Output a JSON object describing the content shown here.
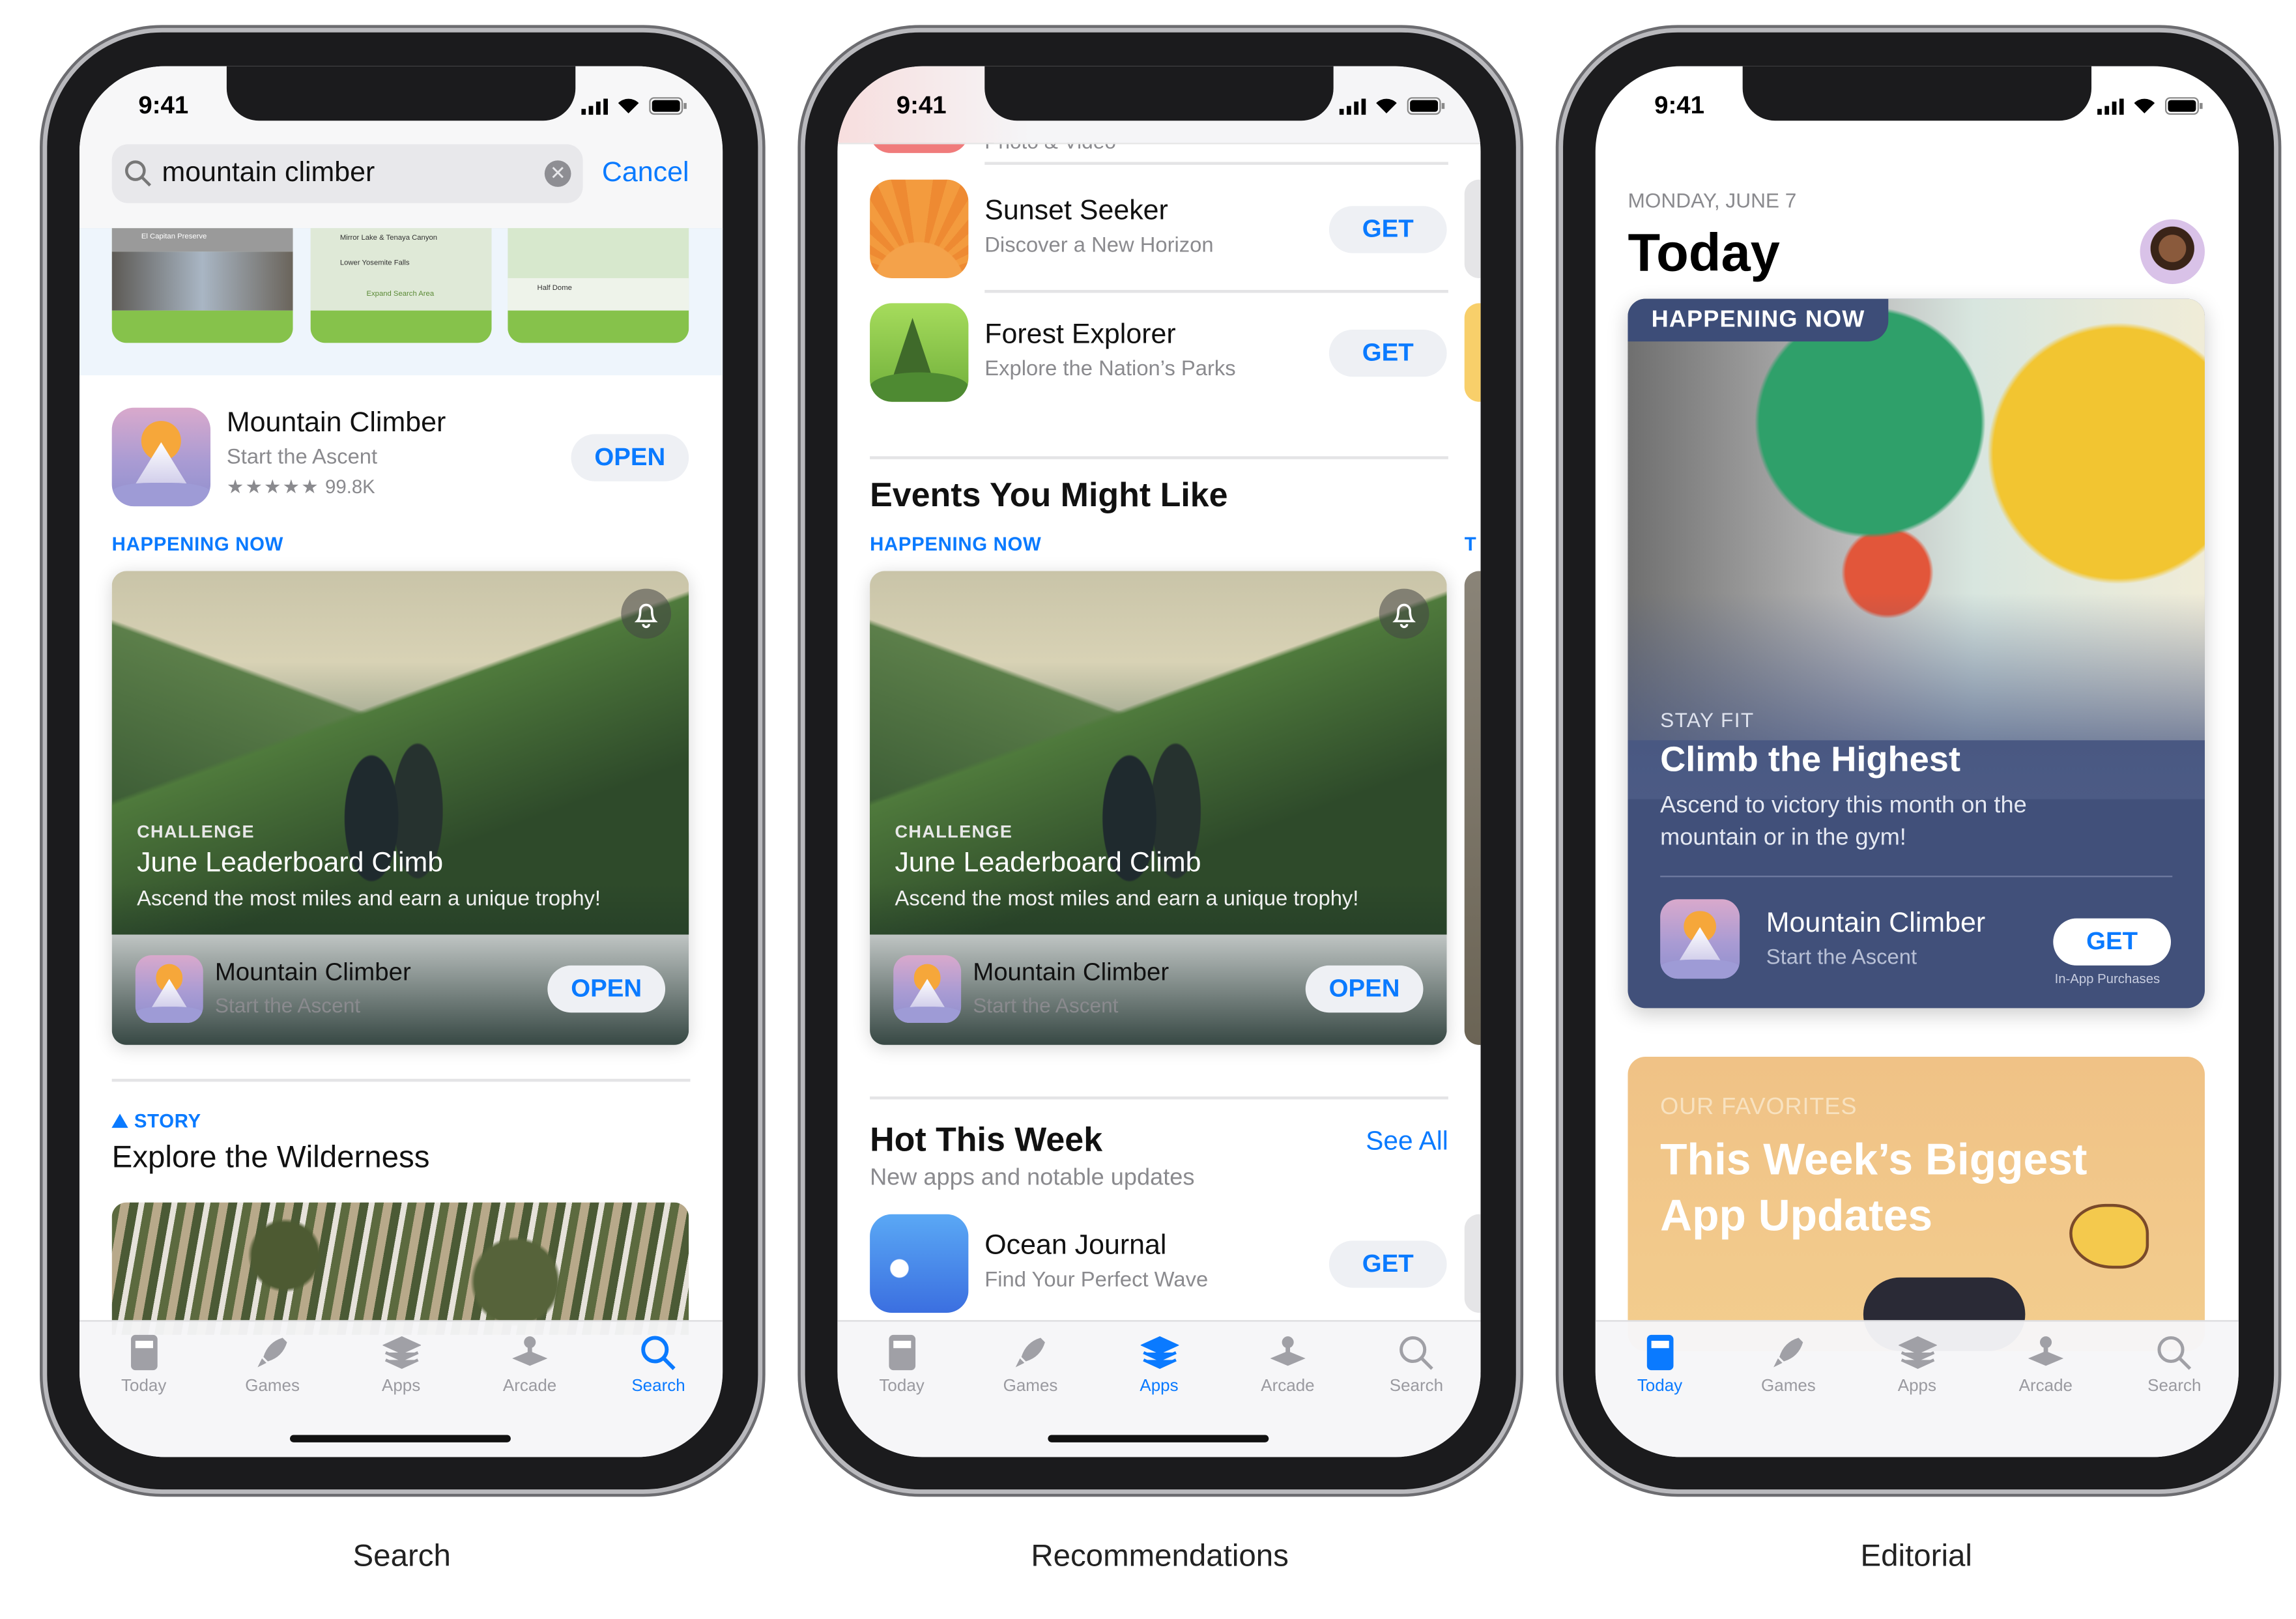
{
  "status_time": "9:41",
  "captions": [
    "Search",
    "Recommendations",
    "Editorial"
  ],
  "colors": {
    "accent": "#0a7aff",
    "tab_inactive": "#9a9aa0",
    "editorial_card": "#41507a",
    "favorites_card": "#f0c27f"
  },
  "tabs": [
    {
      "label": "Today",
      "icon": "today-icon"
    },
    {
      "label": "Games",
      "icon": "rocket-icon"
    },
    {
      "label": "Apps",
      "icon": "layers-icon"
    },
    {
      "label": "Arcade",
      "icon": "joystick-icon"
    },
    {
      "label": "Search",
      "icon": "search-icon"
    }
  ],
  "search_screen": {
    "query": "mountain climber",
    "cancel": "Cancel",
    "screenshots": {
      "thumb1_title": "El Capitan Preserve",
      "thumb2_items": [
        "Mirror Lake & Tenaya Canyon",
        "Lower Yosemite Falls"
      ],
      "thumb2_button": "Expand Search Area",
      "thumb3_title": "Half Dome"
    },
    "app": {
      "name": "Mountain Climber",
      "subtitle": "Start the Ascent",
      "stars": "★★★★★",
      "rating_count": "99.8K",
      "rating": 4.5,
      "button": "OPEN"
    },
    "happening_now": "HAPPENING NOW",
    "event": {
      "kicker": "CHALLENGE",
      "title": "June Leaderboard Climb",
      "description": "Ascend the most miles and earn a unique trophy!",
      "app_name": "Mountain Climber",
      "app_subtitle": "Start the Ascent",
      "button": "OPEN"
    },
    "story_tag": "STORY",
    "story_title": "Explore the Wilderness"
  },
  "recommendations_screen": {
    "cut_off_row": "Photo & Video",
    "apps": [
      {
        "name": "Sunset Seeker",
        "subtitle": "Discover a New Horizon",
        "button": "GET"
      },
      {
        "name": "Forest Explorer",
        "subtitle": "Explore the Nation’s Parks",
        "button": "GET"
      }
    ],
    "events_heading": "Events You Might Like",
    "happening_now": "HAPPENING NOW",
    "peek_label": "T",
    "event": {
      "kicker": "CHALLENGE",
      "title": "June Leaderboard Climb",
      "description": "Ascend the most miles and earn a unique trophy!",
      "app_name": "Mountain Climber",
      "app_subtitle": "Start the Ascent",
      "button": "OPEN"
    },
    "hot_heading": "Hot This Week",
    "hot_subtitle": "New apps and notable updates",
    "see_all": "See All",
    "hot_app": {
      "name": "Ocean Journal",
      "subtitle": "Find Your Perfect Wave",
      "button": "GET"
    }
  },
  "editorial_screen": {
    "date": "MONDAY, JUNE 7",
    "title": "Today",
    "card1": {
      "tag": "HAPPENING NOW",
      "kicker": "STAY FIT",
      "title": "Climb the Highest",
      "description": "Ascend to victory this month on the mountain or in the gym!",
      "app_name": "Mountain Climber",
      "app_subtitle": "Start the Ascent",
      "button": "GET",
      "iap": "In-App Purchases"
    },
    "card2": {
      "kicker": "OUR FAVORITES",
      "title": "This Week’s Biggest App Updates"
    }
  }
}
